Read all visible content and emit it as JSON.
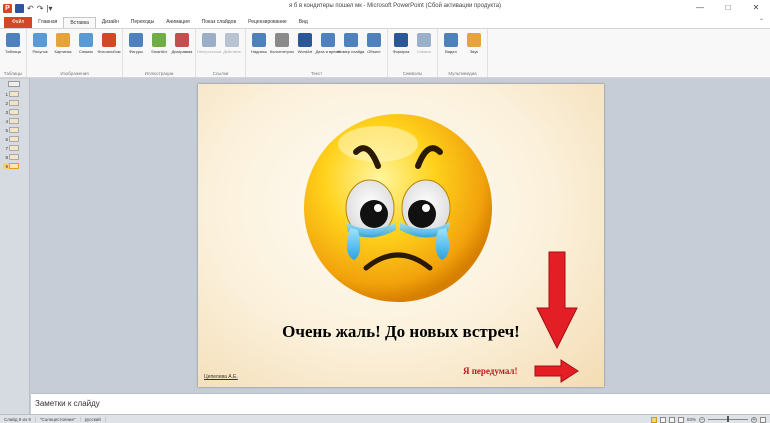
{
  "window": {
    "title": "я б в кондитеры пошел мк - Microsoft PowerPoint (Сбой активации продукта)",
    "minimize": "—",
    "maximize": "□",
    "close": "✕"
  },
  "qat": {
    "undo": "↶",
    "redo": "↷",
    "customize": "|▾"
  },
  "tabs": [
    "Файл",
    "Главная",
    "Вставка",
    "Дизайн",
    "Переходы",
    "Анимация",
    "Показ слайдов",
    "Рецензирование",
    "Вид"
  ],
  "active_tab": "Вставка",
  "ribbon": {
    "groups": [
      {
        "label": "Таблицы",
        "buttons": [
          {
            "label": "Таблица",
            "icon": "table-icon",
            "color": "#4f81bd"
          }
        ]
      },
      {
        "label": "Изображения",
        "buttons": [
          {
            "label": "Рисунок",
            "icon": "picture-icon",
            "color": "#5b9bd5"
          },
          {
            "label": "Картинка",
            "icon": "clipart-icon",
            "color": "#e6a23c"
          },
          {
            "label": "Снимок",
            "icon": "screenshot-icon",
            "color": "#5b9bd5"
          },
          {
            "label": "Фотоальбом",
            "icon": "photo-album-icon",
            "color": "#d24726"
          }
        ]
      },
      {
        "label": "Иллюстрации",
        "buttons": [
          {
            "label": "Фигуры",
            "icon": "shapes-icon",
            "color": "#4f81bd"
          },
          {
            "label": "SmartArt",
            "icon": "smartart-icon",
            "color": "#70ad47"
          },
          {
            "label": "Диаграмма",
            "icon": "chart-icon",
            "color": "#c0504d"
          }
        ]
      },
      {
        "label": "Ссылки",
        "buttons": [
          {
            "label": "Гиперссылка",
            "icon": "hyperlink-icon",
            "color": "#9bb0c8",
            "disabled": true
          },
          {
            "label": "Действие",
            "icon": "action-icon",
            "color": "#b8c4d4",
            "disabled": true
          }
        ]
      },
      {
        "label": "Текст",
        "buttons": [
          {
            "label": "Надпись",
            "icon": "textbox-icon",
            "color": "#4f81bd"
          },
          {
            "label": "Колонтитулы",
            "icon": "header-footer-icon",
            "color": "#8a8a8a"
          },
          {
            "label": "WordArt",
            "icon": "wordart-icon",
            "color": "#2b5797"
          },
          {
            "label": "Дата и время",
            "icon": "datetime-icon",
            "color": "#4f81bd"
          },
          {
            "label": "Номер слайда",
            "icon": "slide-number-icon",
            "color": "#4f81bd"
          },
          {
            "label": "Объект",
            "icon": "object-icon",
            "color": "#4f81bd"
          }
        ]
      },
      {
        "label": "Символы",
        "buttons": [
          {
            "label": "Формула",
            "icon": "equation-icon",
            "color": "#2b5797"
          },
          {
            "label": "Символ",
            "icon": "symbol-icon",
            "color": "#9bb0c8",
            "disabled": true
          }
        ]
      },
      {
        "label": "Мультимедиа",
        "buttons": [
          {
            "label": "Видео",
            "icon": "video-icon",
            "color": "#4f81bd"
          },
          {
            "label": "Звук",
            "icon": "audio-icon",
            "color": "#e6a23c"
          }
        ]
      }
    ]
  },
  "thumbnails": [
    {
      "num": "1"
    },
    {
      "num": "2"
    },
    {
      "num": "3"
    },
    {
      "num": "4"
    },
    {
      "num": "5"
    },
    {
      "num": "6"
    },
    {
      "num": "7"
    },
    {
      "num": "8"
    },
    {
      "num": "9",
      "selected": true
    }
  ],
  "slide": {
    "main_text": "Очень жаль! До новых встреч!",
    "author": "Цепелева А.Е.",
    "changed_mind": "Я передумал!",
    "arrow_color": "#e31e24"
  },
  "notes": {
    "label": "Заметки к слайду"
  },
  "status": {
    "slide_info": "Слайд 9 из 9",
    "theme": "\"Солнцестояние\"",
    "language": "русский",
    "zoom": "83%"
  }
}
